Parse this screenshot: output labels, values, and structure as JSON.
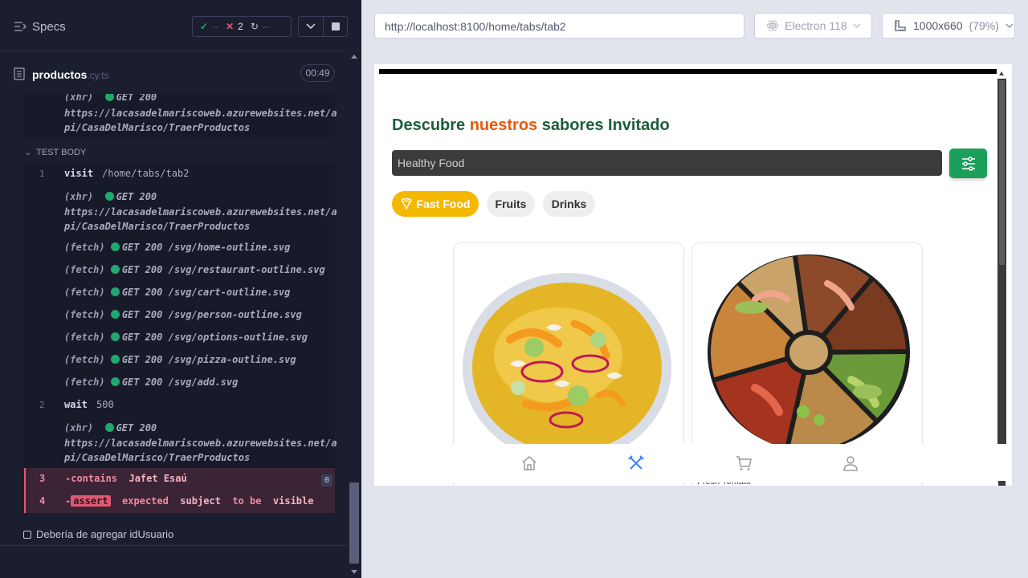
{
  "sidebar": {
    "title": "Specs",
    "stats": {
      "passed": "--",
      "failed": "2",
      "pending": "--"
    },
    "file": {
      "name": "productos",
      "ext": ".cy.ts",
      "duration": "00:49"
    },
    "test_body_label": "TEST BODY",
    "next_test": "Debería de agregar idUsuario"
  },
  "commands": {
    "pre": {
      "type": "(xhr)",
      "status": "GET 200",
      "url1": "https://lacasadelmariscoweb.azurewebsites.net/a",
      "url2": "pi/CasaDelMarisco/TraerProductos"
    },
    "visit": {
      "num": "1",
      "name": "visit",
      "msg": "/home/tabs/tab2"
    },
    "xhr1": {
      "type": "(xhr)",
      "status": "GET 200",
      "url1": "https://lacasadelmariscoweb.azurewebsites.net/a",
      "url2": "pi/CasaDelMarisco/TraerProductos"
    },
    "fetches": [
      {
        "type": "(fetch)",
        "status": "GET 200",
        "path": "/svg/home-outline.svg"
      },
      {
        "type": "(fetch)",
        "status": "GET 200",
        "path": "/svg/restaurant-outline.svg"
      },
      {
        "type": "(fetch)",
        "status": "GET 200",
        "path": "/svg/cart-outline.svg"
      },
      {
        "type": "(fetch)",
        "status": "GET 200",
        "path": "/svg/person-outline.svg"
      },
      {
        "type": "(fetch)",
        "status": "GET 200",
        "path": "/svg/options-outline.svg"
      },
      {
        "type": "(fetch)",
        "status": "GET 200",
        "path": "/svg/pizza-outline.svg"
      },
      {
        "type": "(fetch)",
        "status": "GET 200",
        "path": "/svg/add.svg"
      }
    ],
    "wait": {
      "num": "2",
      "name": "wait",
      "msg": "500"
    },
    "xhr2": {
      "type": "(xhr)",
      "status": "GET 200",
      "url1": "https://lacasadelmariscoweb.azurewebsites.net/a",
      "url2": "pi/CasaDelMarisco/TraerProductos"
    },
    "contains": {
      "num": "3",
      "name": "-contains",
      "msg": "Jafet Esaú",
      "count": "0"
    },
    "assert": {
      "num": "4",
      "prefix": "-",
      "name": "assert",
      "w1": "expected",
      "w2": "subject",
      "w3": "to be",
      "w4": "visible"
    }
  },
  "toolbar": {
    "url": "http://localhost:8100/home/tabs/tab2",
    "browser": "Electron 118",
    "viewport": "1000x660",
    "zoom": "(79%)"
  },
  "app": {
    "title_part1": "Descubre",
    "title_accent": "nuestros",
    "title_part2": "sabores Invitado",
    "search_value": "Healthy Food",
    "chips": [
      "Fast Food",
      "Fruits",
      "Drinks"
    ],
    "card2_label": "Fresh Tomato",
    "tabs": [
      "home-icon",
      "restaurant-icon",
      "cart-icon",
      "person-icon"
    ],
    "active_tab_color": "#3880ff"
  }
}
